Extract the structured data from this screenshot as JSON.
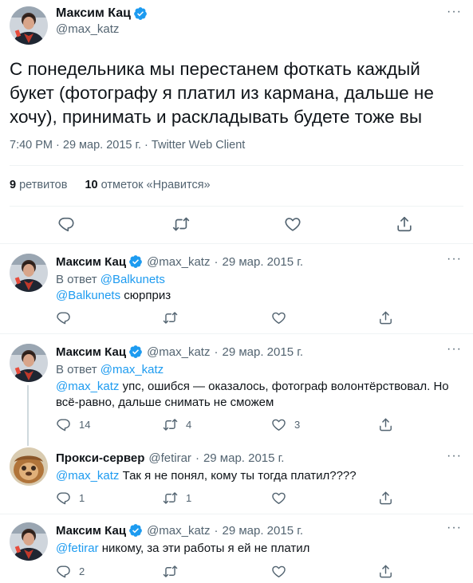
{
  "main_tweet": {
    "author_name": "Максим Кац",
    "author_handle": "@max_katz",
    "text": "С понедельника мы перестанем фоткать каждый букет (фотографу я платил из кармана, дальше не хочу), принимать и раскладывать будете тоже вы",
    "meta": "7:40 PM · 29 мар. 2015 г. · Twitter Web Client",
    "retweets_count": "9",
    "retweets_label": "ретвитов",
    "likes_count": "10",
    "likes_label": "отметок «Нравится»",
    "more": "···"
  },
  "replies": [
    {
      "author_name": "Максим Кац",
      "author_handle": "@max_katz",
      "date": "29 мар. 2015 г.",
      "reply_to_prefix": "В ответ",
      "reply_to": "@Balkunets",
      "mention": "@Balkunets",
      "text": "сюрприз",
      "reply_count": "",
      "retweet_count": "",
      "like_count": "",
      "more": "···"
    },
    {
      "author_name": "Максим Кац",
      "author_handle": "@max_katz",
      "date": "29 мар. 2015 г.",
      "reply_to_prefix": "В ответ",
      "reply_to": "@max_katz",
      "mention": "@max_katz",
      "text": "упс, ошибся — оказалось, фотограф волонтёрствовал. Но всё-равно, дальше снимать не сможем",
      "reply_count": "14",
      "retweet_count": "4",
      "like_count": "3",
      "more": "···"
    },
    {
      "author_name": "Прокси-сервер",
      "author_handle": "@fetirar",
      "date": "29 мар. 2015 г.",
      "mention": "@max_katz",
      "text": "Так я не понял, кому ты тогда платил????",
      "reply_count": "1",
      "retweet_count": "1",
      "like_count": "",
      "more": "···"
    },
    {
      "author_name": "Максим Кац",
      "author_handle": "@max_katz",
      "date": "29 мар. 2015 г.",
      "mention": "@fetirar",
      "text": "никому, за эти работы я ей не платил",
      "reply_count": "2",
      "retweet_count": "",
      "like_count": "",
      "more": "···"
    }
  ],
  "separator": "·",
  "icons": [
    "verified-badge-icon",
    "reply-icon",
    "retweet-icon",
    "like-icon",
    "share-icon",
    "more-icon"
  ],
  "colors": {
    "accent": "#1d9bf0",
    "muted": "#536471",
    "text": "#0f1419",
    "divider": "#eff3f4"
  }
}
